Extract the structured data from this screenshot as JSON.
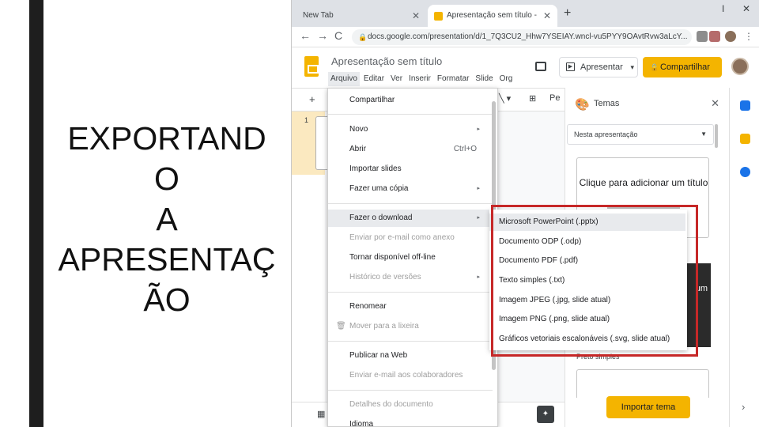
{
  "slide": {
    "title": "EXPORTAND\nO\nA\nAPRESENTAÇ\nÃO"
  },
  "browser": {
    "tabs": [
      {
        "label": "New Tab"
      },
      {
        "label": "Apresentação sem título - Apresc"
      }
    ],
    "new_tab_symbol": "+",
    "window_controls": {
      "minimize": "I",
      "close": "✕"
    },
    "close_symbol": "✕",
    "nav": {
      "back": "←",
      "forward": "→",
      "reload": "C"
    },
    "address": "docs.google.com/presentation/d/1_7Q3CU2_Hhw7YSEIAY.wncl-vu5PYY9OAvtRvw3aLcY..."
  },
  "app": {
    "doc_title": "Apresentação sem título",
    "menus": [
      "Arquivo",
      "Editar",
      "Ver",
      "Inserir",
      "Formatar",
      "Slide",
      "Org"
    ],
    "present_label": "Apresentar",
    "share_label": "Compartilhar",
    "slide_number": "1",
    "toolbar_plus": "+",
    "toolbar_text_tool": "Pe"
  },
  "file_menu": {
    "items": [
      {
        "label": "Compartilhar",
        "shortcut": "",
        "submenu": false,
        "disabled": false
      },
      {
        "label": "Novo",
        "shortcut": "",
        "submenu": true,
        "disabled": false
      },
      {
        "label": "Abrir",
        "shortcut": "Ctrl+O",
        "submenu": false,
        "disabled": false
      },
      {
        "label": "Importar slides",
        "shortcut": "",
        "submenu": false,
        "disabled": false
      },
      {
        "label": "Fazer uma cópia",
        "shortcut": "",
        "submenu": true,
        "disabled": false
      },
      {
        "label": "Fazer o download",
        "shortcut": "",
        "submenu": true,
        "disabled": false
      },
      {
        "label": "Enviar por e-mail como anexo",
        "shortcut": "",
        "submenu": false,
        "disabled": true
      },
      {
        "label": "Tornar disponível off-line",
        "shortcut": "",
        "submenu": false,
        "disabled": false
      },
      {
        "label": "Histórico de versões",
        "shortcut": "",
        "submenu": true,
        "disabled": true
      },
      {
        "label": "Renomear",
        "shortcut": "",
        "submenu": false,
        "disabled": false
      },
      {
        "label": "Mover para a lixeira",
        "shortcut": "",
        "submenu": false,
        "disabled": true
      },
      {
        "label": "Publicar na Web",
        "shortcut": "",
        "submenu": false,
        "disabled": false
      },
      {
        "label": "Enviar e-mail aos colaboradores",
        "shortcut": "",
        "submenu": false,
        "disabled": true
      },
      {
        "label": "Detalhes do documento",
        "shortcut": "",
        "submenu": false,
        "disabled": true
      },
      {
        "label": "Idioma",
        "shortcut": "",
        "submenu": false,
        "disabled": false
      }
    ],
    "submenu_arrow": "▸",
    "trash_icon": "🗑"
  },
  "download_submenu": {
    "items": [
      "Microsoft PowerPoint (.pptx)",
      "Documento ODP (.odp)",
      "Documento PDF (.pdf)",
      "Texto simples (.txt)",
      "Imagem JPEG (.jpg, slide atual)",
      "Imagem PNG (.png, slide atual)",
      "Gráficos vetoriais escalonáveis (.svg, slide atual)"
    ]
  },
  "themes": {
    "title": "Temas",
    "selector": "Nesta apresentação",
    "card_title": "Clique para adicionar um título",
    "dark_card_text": "um",
    "simple_label": "Preto simples",
    "import_label": "Importar tema",
    "rail_chevron": "›"
  },
  "colors": {
    "accent_yellow": "#f4b400",
    "highlight_red": "#c62828",
    "menu_hover": "#e8eaed"
  }
}
